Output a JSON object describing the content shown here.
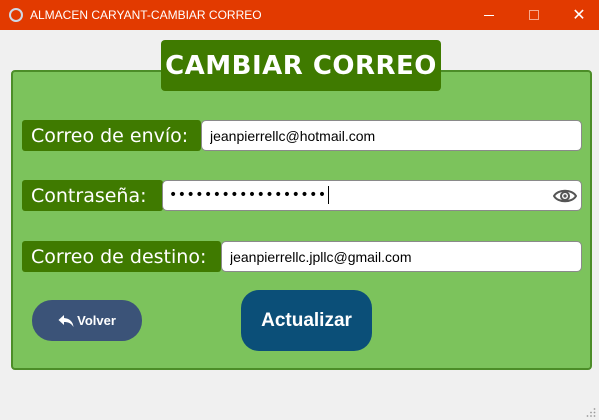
{
  "window": {
    "title": "ALMACEN CARYANT-CAMBIAR CORREO",
    "icon": "app-ring-icon",
    "titlebar_color": "#e23a00"
  },
  "heading": "CAMBIAR CORREO",
  "form": {
    "sender_email": {
      "label": "Correo de envío:",
      "value": "jeanpierrellc@hotmail.com"
    },
    "password": {
      "label": "Contraseña:",
      "masked_value": "••••••••••••••••••",
      "toggle_icon": "eye-icon"
    },
    "destination_email": {
      "label": "Correo de destino:",
      "value": "jeanpierrellc.jpllc@gmail.com"
    }
  },
  "buttons": {
    "back": {
      "label": "Volver",
      "icon": "reply-arrow-icon"
    },
    "update": {
      "label": "Actualizar"
    }
  },
  "colors": {
    "panel": "#7cc35c",
    "label_bg": "#3f7a00",
    "back_button": "#3b5378",
    "update_button": "#0b4f78"
  }
}
